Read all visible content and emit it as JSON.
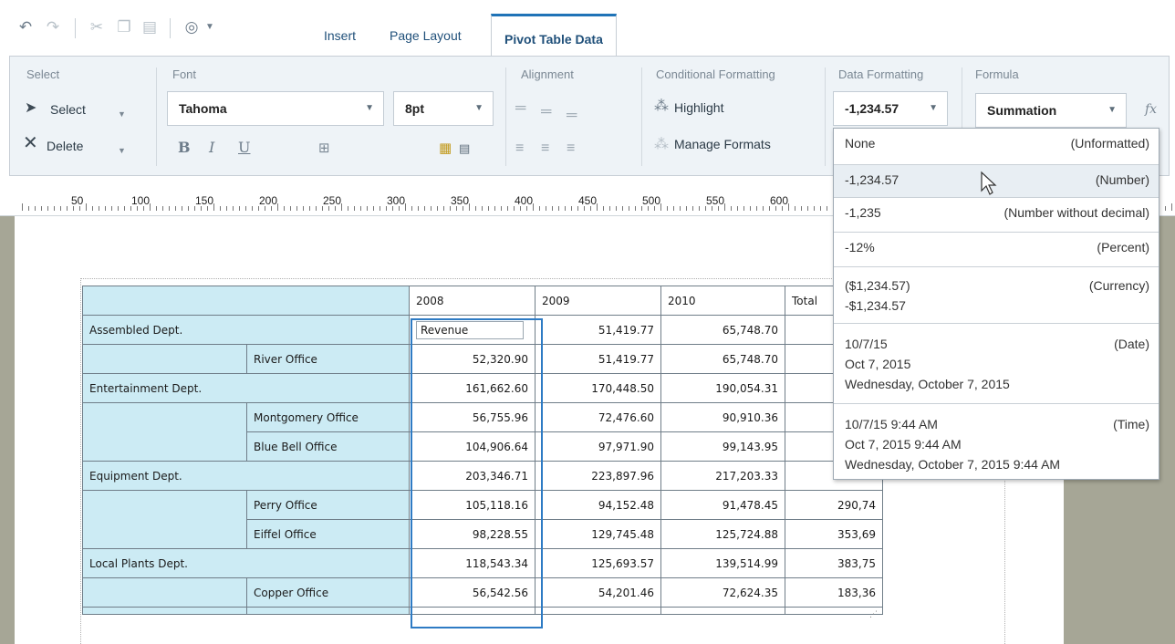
{
  "toolbar": {
    "quick_access": [
      {
        "name": "undo-icon",
        "glyph": "↶"
      },
      {
        "name": "redo-icon",
        "glyph": "↷"
      },
      {
        "name": "cut-icon",
        "glyph": "✂"
      },
      {
        "name": "copy-icon",
        "glyph": "❐"
      },
      {
        "name": "paste-icon",
        "glyph": "▤"
      },
      {
        "name": "preview-icon",
        "glyph": "◎"
      }
    ],
    "tabs": [
      {
        "label": "Insert"
      },
      {
        "label": "Page Layout"
      },
      {
        "label": "Pivot Table Data",
        "active": true
      }
    ]
  },
  "ribbon": {
    "select_group": {
      "title": "Select",
      "select_label": "Select",
      "delete_label": "Delete"
    },
    "font_group": {
      "title": "Font",
      "font_family": "Tahoma",
      "font_size": "8pt",
      "bold": "B",
      "italic": "I",
      "underline": "U"
    },
    "alignment_group": {
      "title": "Alignment"
    },
    "conditional_group": {
      "title": "Conditional Formatting",
      "highlight_label": "Highlight",
      "manage_label": "Manage Formats"
    },
    "data_formatting_group": {
      "title": "Data Formatting",
      "current_value": "-1,234.57"
    },
    "formula_group": {
      "title": "Formula",
      "current_value": "Summation",
      "fx": "fx"
    }
  },
  "ruler": {
    "labels": [
      "50",
      "100",
      "150",
      "200",
      "250",
      "300",
      "350",
      "400",
      "450",
      "500",
      "550",
      "600"
    ]
  },
  "pivot_table": {
    "headers": [
      "2008",
      "2009",
      "2010",
      "Total"
    ],
    "rows": [
      {
        "dept": "Assembled Dept.",
        "office": "",
        "v2008": "Revenue",
        "v2009": "51,419.77",
        "v2010": "65,748.70",
        "total": ""
      },
      {
        "dept": "",
        "office": "River Office",
        "v2008": "52,320.90",
        "v2009": "51,419.77",
        "v2010": "65,748.70",
        "total": ""
      },
      {
        "dept": "Entertainment Dept.",
        "office": "",
        "v2008": "161,662.60",
        "v2009": "170,448.50",
        "v2010": "190,054.31",
        "total": ""
      },
      {
        "dept": "",
        "office": "Montgomery Office",
        "v2008": "56,755.96",
        "v2009": "72,476.60",
        "v2010": "90,910.36",
        "total": ""
      },
      {
        "dept": "",
        "office": "Blue Bell Office",
        "v2008": "104,906.64",
        "v2009": "97,971.90",
        "v2010": "99,143.95",
        "total": ""
      },
      {
        "dept": "Equipment Dept.",
        "office": "",
        "v2008": "203,346.71",
        "v2009": "223,897.96",
        "v2010": "217,203.33",
        "total": ""
      },
      {
        "dept": "",
        "office": "Perry Office",
        "v2008": "105,118.16",
        "v2009": "94,152.48",
        "v2010": "91,478.45",
        "total": "290,74"
      },
      {
        "dept": "",
        "office": "Eiffel Office",
        "v2008": "98,228.55",
        "v2009": "129,745.48",
        "v2010": "125,724.88",
        "total": "353,69"
      },
      {
        "dept": "Local Plants Dept.",
        "office": "",
        "v2008": "118,543.34",
        "v2009": "125,693.57",
        "v2010": "139,514.99",
        "total": "383,75"
      },
      {
        "dept": "",
        "office": "Copper Office",
        "v2008": "56,542.56",
        "v2009": "54,201.46",
        "v2010": "72,624.35",
        "total": "183,36"
      }
    ]
  },
  "format_dropdown": {
    "options": [
      {
        "left": [
          "None"
        ],
        "right": "(Unformatted)"
      },
      {
        "left": [
          "-1,234.57"
        ],
        "right": "(Number)",
        "selected": true
      },
      {
        "left": [
          "-1,235"
        ],
        "right": "(Number without decimal)"
      },
      {
        "left": [
          "-12%"
        ],
        "right": "(Percent)"
      },
      {
        "left": [
          "($1,234.57)",
          "-$1,234.57"
        ],
        "right": "(Currency)"
      },
      {
        "left": [
          "10/7/15",
          "Oct 7, 2015",
          "Wednesday, October 7, 2015"
        ],
        "right": "(Date)"
      },
      {
        "left": [
          "10/7/15 9:44 AM",
          "Oct 7, 2015 9:44 AM",
          "Wednesday, October 7, 2015 9:44 AM"
        ],
        "right": "(Time)"
      }
    ]
  },
  "colors": {
    "accent": "#1f73b7",
    "table_label_bg": "#ccebf4",
    "selection": "#2e7bc4",
    "desk": "#a6a696"
  }
}
